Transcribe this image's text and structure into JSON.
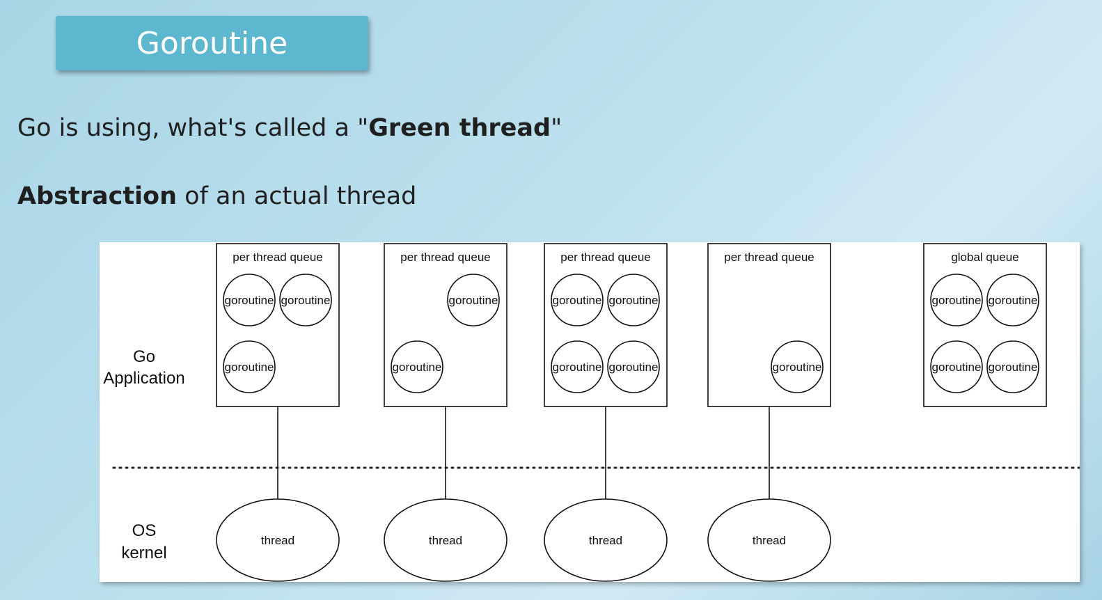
{
  "title": "Goroutine",
  "line1": {
    "prefix": "Go is using, what's called a \"",
    "bold": "Green thread",
    "suffix": "\""
  },
  "line2": {
    "bold": "Abstraction",
    "rest": " of an actual thread"
  },
  "diagram": {
    "layer_top_label_line1": "Go",
    "layer_top_label_line2": "Application",
    "layer_bottom_label_line1": "OS",
    "layer_bottom_label_line2": "kernel",
    "goroutine_label": "goroutine",
    "thread_label": "thread",
    "queues": [
      {
        "label": "per thread queue",
        "goroutine_slots": [
          "top-left",
          "top-right",
          "bottom-left"
        ],
        "has_thread": true
      },
      {
        "label": "per thread queue",
        "goroutine_slots": [
          "top-right",
          "bottom-left"
        ],
        "has_thread": true
      },
      {
        "label": "per thread queue",
        "goroutine_slots": [
          "top-left",
          "top-right",
          "bottom-left",
          "bottom-right"
        ],
        "has_thread": true
      },
      {
        "label": "per thread queue",
        "goroutine_slots": [
          "bottom-right"
        ],
        "has_thread": true
      },
      {
        "label": "global queue",
        "goroutine_slots": [
          "top-left",
          "top-right",
          "bottom-left",
          "bottom-right"
        ],
        "has_thread": false
      }
    ]
  }
}
